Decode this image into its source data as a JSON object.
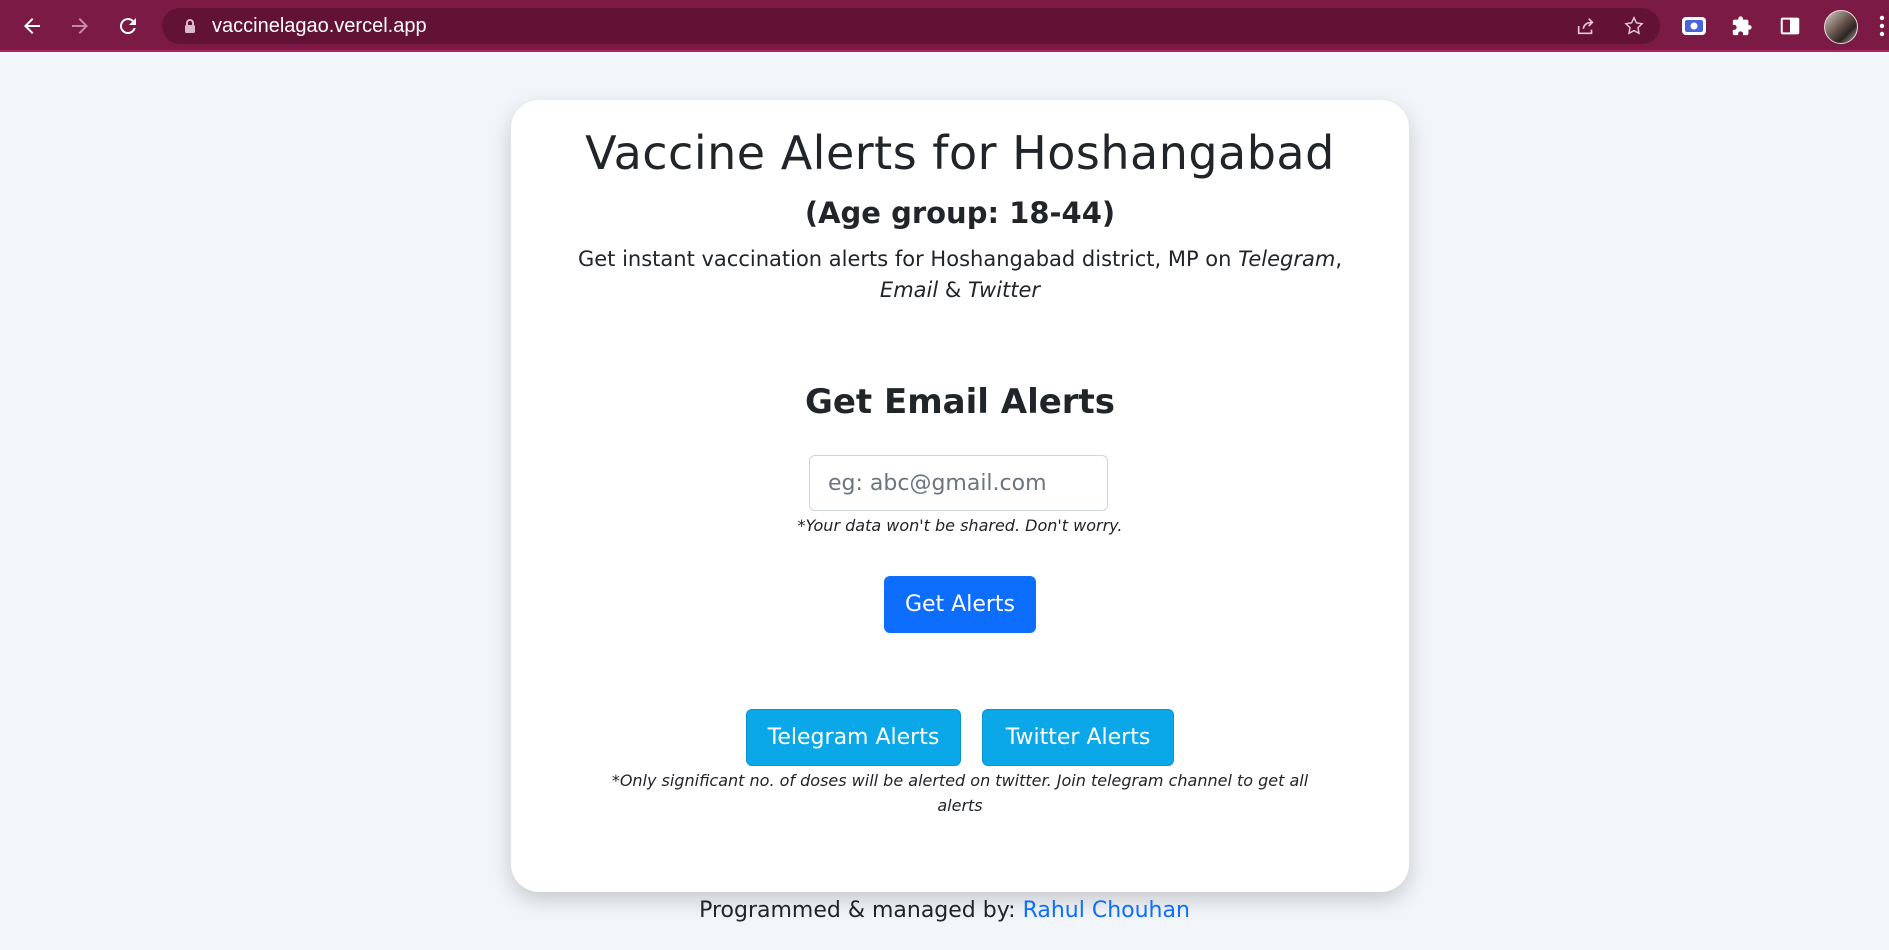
{
  "browser": {
    "url": "vaccinelagao.vercel.app",
    "frame_color": "#7b1a45"
  },
  "page": {
    "title": "Vaccine Alerts for Hoshangabad",
    "subtitle": "(Age group: 18-44)",
    "description_prefix": "Get instant vaccination alerts for Hoshangabad district, MP on ",
    "description_telegram": "Telegram",
    "description_sep1": ", ",
    "description_email": "Email",
    "description_sep2": " & ",
    "description_twitter": "Twitter",
    "email_section": {
      "heading": "Get Email Alerts",
      "placeholder": "eg: abc@gmail.com",
      "privacy_note": "*Your data won't be shared. Don't worry.",
      "submit_label": "Get Alerts"
    },
    "social": {
      "telegram_label": "Telegram Alerts",
      "twitter_label": "Twitter Alerts",
      "note": "*Only significant no. of doses will be alerted on twitter. Join telegram channel to get all alerts"
    },
    "footer": {
      "prefix": "Programmed & managed by: ",
      "author": "Rahul Chouhan"
    },
    "colors": {
      "primary": "#0d6efd",
      "info": "#0aa8e8",
      "background": "#f2f5f9"
    }
  }
}
